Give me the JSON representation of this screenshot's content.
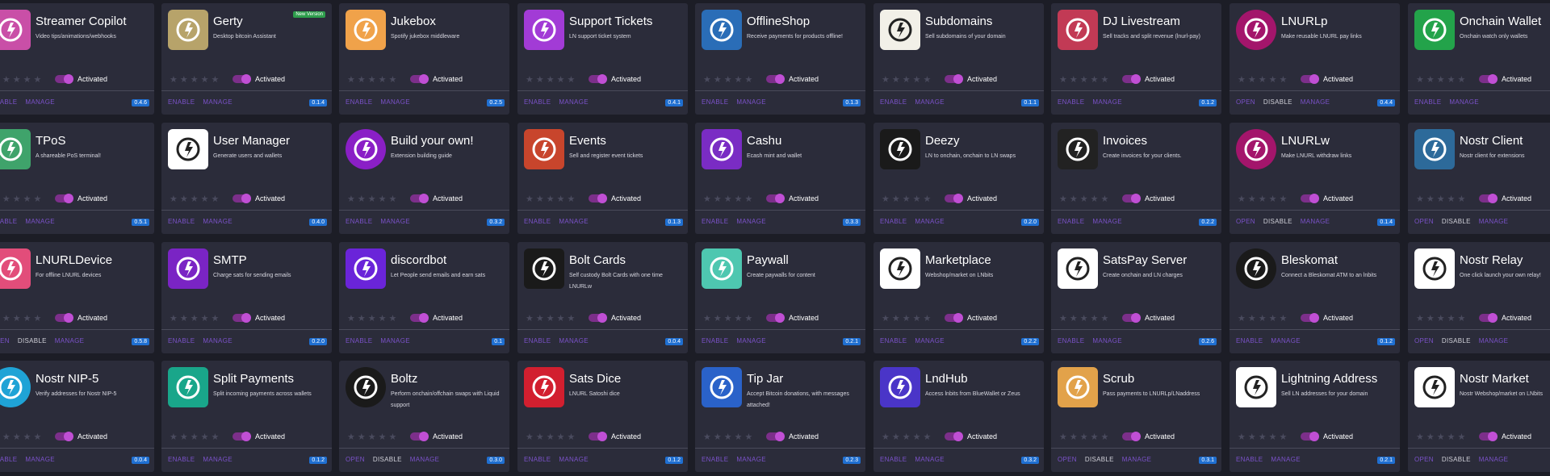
{
  "labels": {
    "status": "Activated",
    "stars": "★★★★★",
    "open": "OPEN",
    "disable": "DISABLE",
    "enable": "ENABLE",
    "manage": "MANAGE",
    "new_version": "New Version"
  },
  "colors": {
    "accent": "#7b52c9",
    "badge": "#1f6fd1",
    "card": "#2b2c3a",
    "background": "#1c1d26",
    "toggle": "#c04fd4"
  },
  "extensions": [
    {
      "title": "Streamer Copilot",
      "desc": "Video tips/animations/webhooks",
      "version": "0.4.6",
      "actions": [
        "ENABLE",
        "MANAGE"
      ],
      "icon": "streamer-copilot-icon",
      "color": "#c94fa7"
    },
    {
      "title": "Gerty",
      "desc": "Desktop bitcoin Assistant",
      "version": "0.1.4",
      "actions": [
        "ENABLE",
        "MANAGE"
      ],
      "icon": "gerty-icon",
      "color": "#b7a36a",
      "badge": "New Version"
    },
    {
      "title": "Jukebox",
      "desc": "Spotify jukebox middleware",
      "version": "0.2.5",
      "actions": [
        "ENABLE",
        "MANAGE"
      ],
      "icon": "jukebox-icon",
      "color": "#f0a24a"
    },
    {
      "title": "Support Tickets",
      "desc": "LN support ticket system",
      "version": "0.4.1",
      "actions": [
        "ENABLE",
        "MANAGE"
      ],
      "icon": "support-tickets-icon",
      "color": "#a23bd6"
    },
    {
      "title": "OfflineShop",
      "desc": "Receive payments for products offline!",
      "version": "0.1.3",
      "actions": [
        "ENABLE",
        "MANAGE"
      ],
      "icon": "offline-shop-icon",
      "color": "#2a6db7"
    },
    {
      "title": "Subdomains",
      "desc": "Sell subdomains of your domain",
      "version": "0.1.1",
      "actions": [
        "ENABLE",
        "MANAGE"
      ],
      "icon": "subdomains-icon",
      "color": "#f2f0e8"
    },
    {
      "title": "DJ Livestream",
      "desc": "Sell tracks and split revenue (lnurl-pay)",
      "version": "0.1.2",
      "actions": [
        "ENABLE",
        "MANAGE"
      ],
      "icon": "dj-livestream-icon",
      "color": "#c23a55"
    },
    {
      "title": "LNURLp",
      "desc": "Make reusable LNURL pay links",
      "version": "0.4.4",
      "actions": [
        "OPEN",
        "DISABLE",
        "MANAGE"
      ],
      "icon": "lnurlp-icon",
      "color": "#a3156b",
      "round": true
    },
    {
      "title": "Onchain Wallet",
      "desc": "Onchain watch only wallets",
      "version": "",
      "actions": [
        "ENABLE",
        "MANAGE"
      ],
      "icon": "onchain-wallet-icon",
      "color": "#23a34a"
    },
    {
      "title": "TPoS",
      "desc": "A shareable PoS terminal!",
      "version": "0.5.1",
      "actions": [
        "ENABLE",
        "MANAGE"
      ],
      "icon": "tpos-icon",
      "color": "#3fa36b"
    },
    {
      "title": "User Manager",
      "desc": "Generate users and wallets",
      "version": "0.4.0",
      "actions": [
        "ENABLE",
        "MANAGE"
      ],
      "icon": "user-manager-icon",
      "color": "#ffffff"
    },
    {
      "title": "Build your own!",
      "desc": "Extension building guide",
      "version": "0.3.2",
      "actions": [
        "ENABLE",
        "MANAGE"
      ],
      "icon": "build-your-own-icon",
      "color": "#8a1fc6",
      "round": true
    },
    {
      "title": "Events",
      "desc": "Sell and register event tickets",
      "version": "0.1.3",
      "actions": [
        "ENABLE",
        "MANAGE"
      ],
      "icon": "events-icon",
      "color": "#c8452c"
    },
    {
      "title": "Cashu",
      "desc": "Ecash mint and wallet",
      "version": "0.3.3",
      "actions": [
        "ENABLE",
        "MANAGE"
      ],
      "icon": "cashu-icon",
      "color": "#7a2cc4"
    },
    {
      "title": "Deezy",
      "desc": "LN to onchain, onchain to LN swaps",
      "version": "0.2.0",
      "actions": [
        "ENABLE",
        "MANAGE"
      ],
      "icon": "deezy-icon",
      "color": "#1a1a1a"
    },
    {
      "title": "Invoices",
      "desc": "Create invoices for your clients.",
      "version": "0.2.2",
      "actions": [
        "ENABLE",
        "MANAGE"
      ],
      "icon": "invoices-icon",
      "color": "#222222"
    },
    {
      "title": "LNURLw",
      "desc": "Make LNURL withdraw links",
      "version": "0.1.4",
      "actions": [
        "OPEN",
        "DISABLE",
        "MANAGE"
      ],
      "icon": "lnurlw-icon",
      "color": "#a3156b",
      "round": true
    },
    {
      "title": "Nostr Client",
      "desc": "Nostr client for extensions",
      "version": "",
      "actions": [
        "OPEN",
        "DISABLE",
        "MANAGE"
      ],
      "icon": "nostr-client-icon",
      "color": "#2d6a9a"
    },
    {
      "title": "LNURLDevice",
      "desc": "For offline LNURL devices",
      "version": "0.5.8",
      "actions": [
        "OPEN",
        "DISABLE",
        "MANAGE"
      ],
      "icon": "lnurl-device-icon",
      "color": "#e24d7a"
    },
    {
      "title": "SMTP",
      "desc": "Charge sats for sending emails",
      "version": "0.2.0",
      "actions": [
        "ENABLE",
        "MANAGE"
      ],
      "icon": "smtp-icon",
      "color": "#7a24c4"
    },
    {
      "title": "discordbot",
      "desc": "Let People send emails and earn sats",
      "version": "0.1",
      "actions": [
        "ENABLE",
        "MANAGE"
      ],
      "icon": "discordbot-icon",
      "color": "#6a24d9"
    },
    {
      "title": "Bolt Cards",
      "desc": "Self custody Bolt Cards with one time LNURLw",
      "version": "0.0.4",
      "actions": [
        "ENABLE",
        "MANAGE"
      ],
      "icon": "bolt-cards-icon",
      "color": "#1a1a1a"
    },
    {
      "title": "Paywall",
      "desc": "Create paywalls for content",
      "version": "0.2.1",
      "actions": [
        "ENABLE",
        "MANAGE"
      ],
      "icon": "paywall-icon",
      "color": "#4ec7b0"
    },
    {
      "title": "Marketplace",
      "desc": "Webshop/market on LNbits",
      "version": "0.2.2",
      "actions": [
        "ENABLE",
        "MANAGE"
      ],
      "icon": "marketplace-icon",
      "color": "#ffffff"
    },
    {
      "title": "SatsPay Server",
      "desc": "Create onchain and LN charges",
      "version": "0.2.6",
      "actions": [
        "ENABLE",
        "MANAGE"
      ],
      "icon": "satspay-server-icon",
      "color": "#ffffff"
    },
    {
      "title": "Bleskomat",
      "desc": "Connect a Bleskomat ATM to an lnbits",
      "version": "0.1.2",
      "actions": [
        "ENABLE",
        "MANAGE"
      ],
      "icon": "bleskomat-icon",
      "color": "#1a1a1a",
      "round": true
    },
    {
      "title": "Nostr Relay",
      "desc": "One click launch your own relay!",
      "version": "",
      "actions": [
        "OPEN",
        "DISABLE",
        "MANAGE"
      ],
      "icon": "nostr-relay-icon",
      "color": "#ffffff"
    },
    {
      "title": "Nostr NIP-5",
      "desc": "Verify addresses for Nostr NIP-5",
      "version": "0.0.4",
      "actions": [
        "ENABLE",
        "MANAGE"
      ],
      "icon": "nostr-nip5-icon",
      "color": "#1fa3d6",
      "round": true
    },
    {
      "title": "Split Payments",
      "desc": "Split incoming payments across wallets",
      "version": "0.1.2",
      "actions": [
        "ENABLE",
        "MANAGE"
      ],
      "icon": "split-payments-icon",
      "color": "#19a68a"
    },
    {
      "title": "Boltz",
      "desc": "Perform onchain/offchain swaps with Liquid support",
      "version": "0.3.0",
      "actions": [
        "OPEN",
        "DISABLE",
        "MANAGE"
      ],
      "icon": "boltz-icon",
      "color": "#1a1a1a",
      "round": true
    },
    {
      "title": "Sats Dice",
      "desc": "LNURL Satoshi dice",
      "version": "0.1.2",
      "actions": [
        "ENABLE",
        "MANAGE"
      ],
      "icon": "sats-dice-icon",
      "color": "#d21f2f"
    },
    {
      "title": "Tip Jar",
      "desc": "Accept Bitcoin donations, with messages attached!",
      "version": "0.2.3",
      "actions": [
        "ENABLE",
        "MANAGE"
      ],
      "icon": "tip-jar-icon",
      "color": "#2a62c9"
    },
    {
      "title": "LndHub",
      "desc": "Access lnbits from BlueWallet or Zeus",
      "version": "0.3.2",
      "actions": [
        "ENABLE",
        "MANAGE"
      ],
      "icon": "lndhub-icon",
      "color": "#4a35c8"
    },
    {
      "title": "Scrub",
      "desc": "Pass payments to LNURLp/LNaddress",
      "version": "0.3.1",
      "actions": [
        "OPEN",
        "DISABLE",
        "MANAGE"
      ],
      "icon": "scrub-icon",
      "color": "#e2a24a"
    },
    {
      "title": "Lightning Address",
      "desc": "Sell LN addresses for your domain",
      "version": "0.2.1",
      "actions": [
        "ENABLE",
        "MANAGE"
      ],
      "icon": "lightning-address-icon",
      "color": "#ffffff"
    },
    {
      "title": "Nostr Market",
      "desc": "Nostr Webshop/market on LNbits",
      "version": "",
      "actions": [
        "OPEN",
        "DISABLE",
        "MANAGE"
      ],
      "icon": "nostr-market-icon",
      "color": "#ffffff"
    }
  ]
}
